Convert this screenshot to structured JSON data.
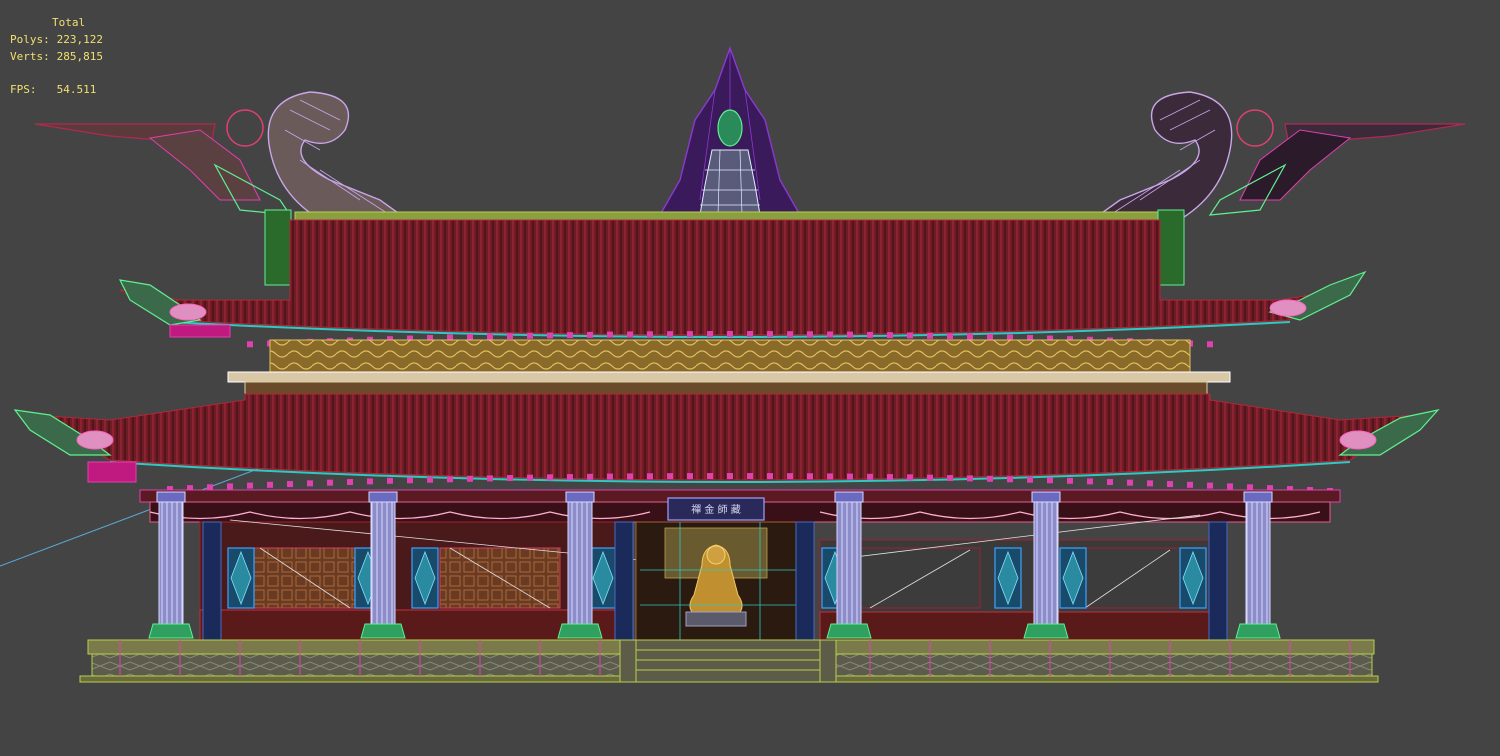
{
  "stats": {
    "total_label": "Total",
    "polys_label": "Polys:",
    "polys_value": "223,122",
    "verts_label": "Verts:",
    "verts_value": "285,815",
    "fps_label": "FPS:",
    "fps_value": "54.511"
  },
  "viewport": {
    "background": "#444444",
    "model": "temple-hall-wireframe"
  },
  "plaque": {
    "text": "禪 金 師 藏"
  },
  "colors": {
    "roof_tile": "#7a1f2a",
    "roof_wire": "#b0283a",
    "ridge_wire": "#b8d04a",
    "dragon_wire": "#c9a6e8",
    "flame_wire": "#6a2a9a",
    "column_wire": "#b8b8ee",
    "base_wire": "#b8d04a",
    "magenta_wire": "#e040b0",
    "green_wire": "#60f090",
    "teal_wire": "#30c8c0"
  }
}
